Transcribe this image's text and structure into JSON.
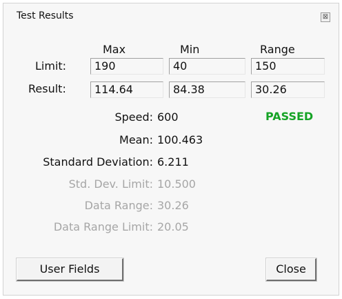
{
  "window": {
    "title": "Test Results",
    "close_glyph": "⊠"
  },
  "columns": {
    "max": "Max",
    "min": "Min",
    "range": "Range"
  },
  "limit": {
    "label": "Limit:",
    "max": "190",
    "min": "40",
    "range": "150"
  },
  "result": {
    "label": "Result:",
    "max": "114.64",
    "min": "84.38",
    "range": "30.26"
  },
  "stats": {
    "speed_label": "Speed:",
    "speed_value": "600",
    "status": "PASSED",
    "mean_label": "Mean:",
    "mean_value": "100.463",
    "stddev_label": "Standard Deviation:",
    "stddev_value": "6.211",
    "stddev_limit_label": "Std. Dev. Limit:",
    "stddev_limit_value": "10.500",
    "data_range_label": "Data Range:",
    "data_range_value": "30.26",
    "data_range_limit_label": "Data Range Limit:",
    "data_range_limit_value": "20.05"
  },
  "buttons": {
    "user_fields": "User Fields",
    "close": "Close"
  },
  "colors": {
    "passed": "#16a326",
    "disabled_text": "#a6a6a6"
  }
}
